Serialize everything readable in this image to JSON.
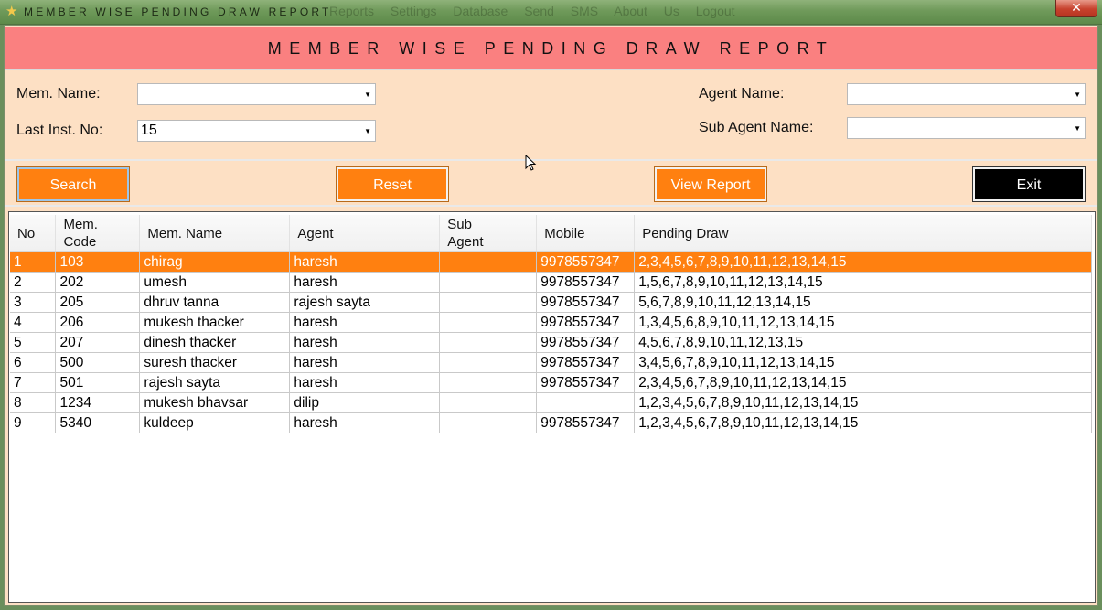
{
  "window": {
    "title": "MEMBER  WISE  PENDING  DRAW  REPORT",
    "background_menu": "Reports  Settings  Database  Send SMS  About Us  Logout",
    "close_glyph": "✕"
  },
  "header": {
    "title": "MEMBER  WISE  PENDING  DRAW  REPORT"
  },
  "form": {
    "mem_name": {
      "label": "Mem. Name:",
      "value": ""
    },
    "last_inst_no": {
      "label": "Last Inst. No:",
      "value": "15"
    },
    "agent_name": {
      "label": "Agent Name:",
      "value": ""
    },
    "sub_agent_name": {
      "label": "Sub Agent Name:",
      "value": ""
    }
  },
  "buttons": {
    "search": "Search",
    "reset": "Reset",
    "view_report": "View Report",
    "exit": "Exit"
  },
  "grid": {
    "columns": [
      "No",
      "Mem.\nCode",
      "Mem. Name",
      "Agent",
      "Sub\nAgent",
      "Mobile",
      "Pending Draw"
    ],
    "selected_row": 0,
    "rows": [
      [
        "1",
        "103",
        "chirag",
        "haresh",
        "",
        "9978557347",
        "2,3,4,5,6,7,8,9,10,11,12,13,14,15"
      ],
      [
        "2",
        "202",
        "umesh",
        "haresh",
        "",
        "9978557347",
        "1,5,6,7,8,9,10,11,12,13,14,15"
      ],
      [
        "3",
        "205",
        "dhruv tanna",
        "rajesh sayta",
        "",
        "9978557347",
        "5,6,7,8,9,10,11,12,13,14,15"
      ],
      [
        "4",
        "206",
        "mukesh thacker",
        "haresh",
        "",
        "9978557347",
        "1,3,4,5,6,8,9,10,11,12,13,14,15"
      ],
      [
        "5",
        "207",
        "dinesh thacker",
        "haresh",
        "",
        "9978557347",
        "4,5,6,7,8,9,10,11,12,13,15"
      ],
      [
        "6",
        "500",
        "suresh thacker",
        "haresh",
        "",
        "9978557347",
        "3,4,5,6,7,8,9,10,11,12,13,14,15"
      ],
      [
        "7",
        "501",
        "rajesh sayta",
        "haresh",
        "",
        "9978557347",
        "2,3,4,5,6,7,8,9,10,11,12,13,14,15"
      ],
      [
        "8",
        "1234",
        "mukesh bhavsar",
        "dilip",
        "",
        "",
        "1,2,3,4,5,6,7,8,9,10,11,12,13,14,15"
      ],
      [
        "9",
        "5340",
        "kuldeep",
        "haresh",
        "",
        "9978557347",
        "1,2,3,4,5,6,7,8,9,10,11,12,13,14,15"
      ]
    ]
  },
  "icons": {
    "app": "star-icon",
    "dropdown": "dropdown-arrow-icon",
    "cursor": "mouse-cursor-icon"
  },
  "colors": {
    "header": "#fa8080",
    "panel": "#fde0c4",
    "accent": "#ff8010",
    "exit": "#000000"
  }
}
